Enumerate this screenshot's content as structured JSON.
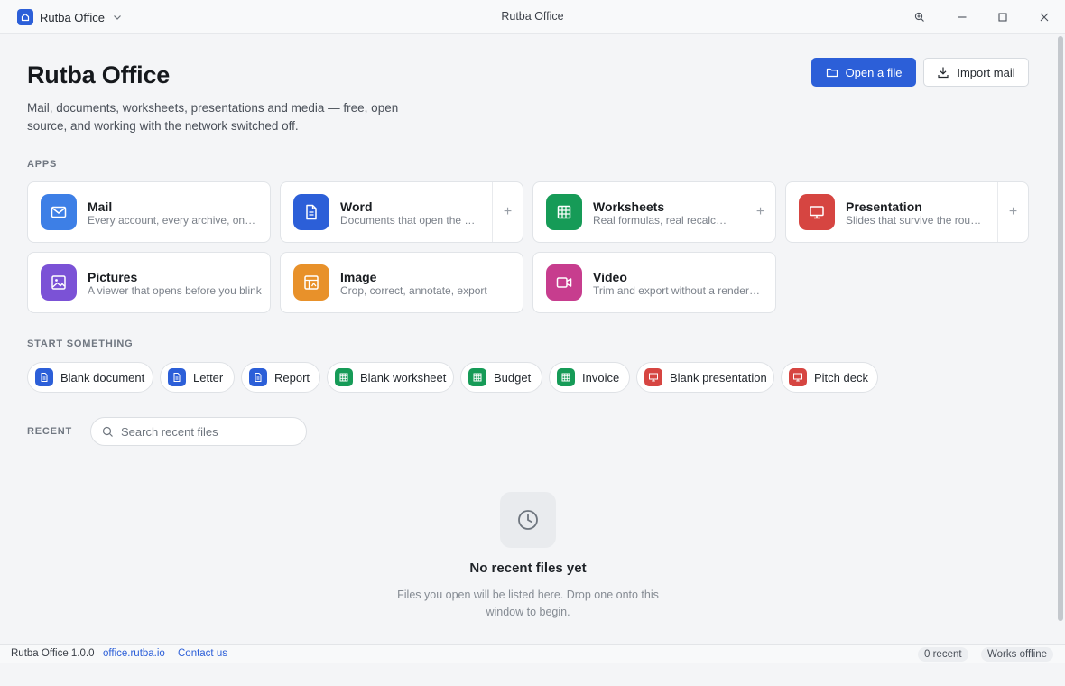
{
  "window": {
    "app_menu_label": "Rutba Office",
    "title": "Rutba Office"
  },
  "header": {
    "title": "Rutba Office",
    "subtitle": "Mail, documents, worksheets, presentations and media — free, open source, and working with the network switched off.",
    "open_file_label": "Open a file",
    "import_mail_label": "Import mail"
  },
  "apps": {
    "section_label": "APPS",
    "items": [
      {
        "name": "Mail",
        "description": "Every account, every archive, one inbox",
        "color": "#3d7fe6",
        "icon": "mail-icon"
      },
      {
        "name": "Word",
        "description": "Documents that open the same everywhere",
        "color": "#2c5fd8",
        "icon": "document-icon",
        "new": "+"
      },
      {
        "name": "Worksheets",
        "description": "Real formulas, real recalculation",
        "color": "#169b57",
        "icon": "grid-icon",
        "new": "+"
      },
      {
        "name": "Presentation",
        "description": "Slides that survive the round trip",
        "color": "#d64541",
        "icon": "presentation-icon",
        "new": "+"
      },
      {
        "name": "Pictures",
        "description": "A viewer that opens before you blink",
        "color": "#7b52d6",
        "icon": "picture-icon"
      },
      {
        "name": "Image",
        "description": "Crop, correct, annotate, export",
        "color": "#e8912a",
        "icon": "image-edit-icon"
      },
      {
        "name": "Video",
        "description": "Trim and export without a render farm",
        "color": "#c73d8e",
        "icon": "video-icon"
      }
    ]
  },
  "templates": {
    "section_label": "START SOMETHING",
    "items": [
      {
        "label": "Blank document",
        "kind": "document"
      },
      {
        "label": "Letter",
        "kind": "document"
      },
      {
        "label": "Report",
        "kind": "document"
      },
      {
        "label": "Blank worksheet",
        "kind": "worksheet"
      },
      {
        "label": "Budget",
        "kind": "worksheet"
      },
      {
        "label": "Invoice",
        "kind": "worksheet"
      },
      {
        "label": "Blank presentation",
        "kind": "presentation"
      },
      {
        "label": "Pitch deck",
        "kind": "presentation"
      }
    ]
  },
  "recent": {
    "section_label": "RECENT",
    "search_placeholder": "Search recent files",
    "empty_title": "No recent files yet",
    "empty_description": "Files you open will be listed here. Drop one onto this window to begin."
  },
  "status": {
    "version": "Rutba Office 1.0.0",
    "website": "office.rutba.io",
    "contact": "Contact us",
    "recent_count": "0 recent",
    "offline": "Works offline"
  },
  "colors": {
    "accent": "#2c5fd8",
    "document": "#2c5fd8",
    "worksheet": "#169b57",
    "presentation": "#d64541"
  }
}
